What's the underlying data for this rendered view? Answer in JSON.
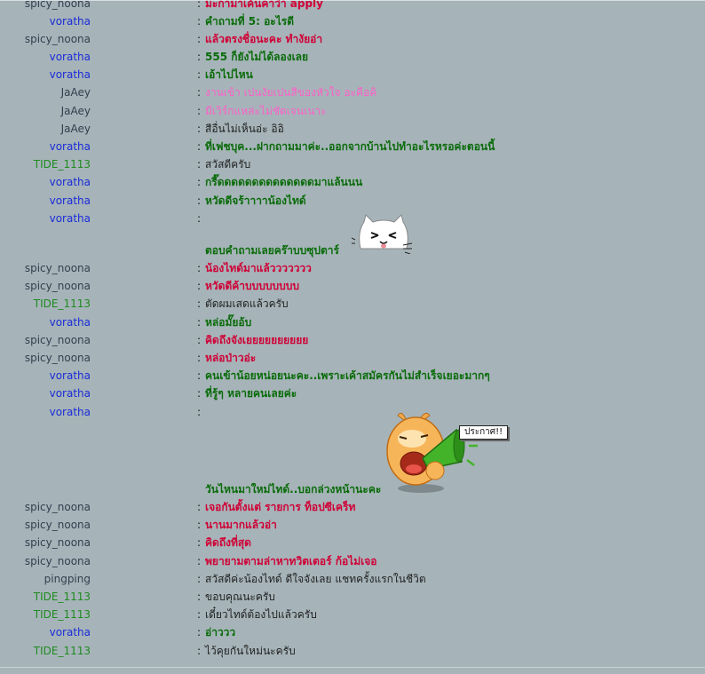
{
  "colors": {
    "background": "#a6b4b9",
    "spicy_noona": "#333e4f",
    "voratha": "#1b2bd8",
    "jaaey": "#333e4f",
    "tide": "#1f8a1f",
    "pingping": "#333e4f",
    "msg_red": "#d00036",
    "msg_green": "#0a6b0a",
    "msg_pink": "#ff5fc8",
    "msg_dark": "#222222"
  },
  "messages": [
    {
      "nick": "spicy_noona",
      "text": "มะกามาเค้นคาว่า apply"
    },
    {
      "nick": "voratha",
      "text": "คำถามที่ 5: อะไรดี"
    },
    {
      "nick": "spicy_noona",
      "text": "แล้วตรงชื่อนะคะ ทำงัยอ่า"
    },
    {
      "nick": "voratha",
      "text": "555 ก็ยังไม่ได้ลองเลย"
    },
    {
      "nick": "voratha",
      "text": "เอ้าไปไหน"
    },
    {
      "nick": "JaAey",
      "text": "งานเข้า เปนงัยเปนสีของหัวใจ อะคือคิ"
    },
    {
      "nick": "JaAey",
      "text": "มีเวิร์กแหล่ะไม่ชัดเจนเนาะ"
    },
    {
      "nick": "JaAey",
      "text": "สีอื่นไม่เห็นอ่ะ อิอิ"
    },
    {
      "nick": "voratha",
      "text": "ที่เฟชบุค...ฝากถามมาค่ะ..ออกจากบ้านไปทำอะไรหรอค่ะตอนนี้"
    },
    {
      "nick": "TIDE_1113",
      "text": "สวัสดีครับ"
    },
    {
      "nick": "voratha",
      "text": "กรี๊ดดดดดดดดดดดดดดมาแล้นนน"
    },
    {
      "nick": "voratha",
      "text": "หวัดดีจร้าาาาน้องไทด์"
    },
    {
      "nick": "voratha",
      "text": ""
    },
    {
      "nick": "spicy_noona",
      "text": "น้องไทด์มาแล้ววววววว"
    },
    {
      "nick": "spicy_noona",
      "text": "หวัดดีค้าบบบบบบบบ"
    },
    {
      "nick": "TIDE_1113",
      "text": "ตัดผมเสดแล้วครับ"
    },
    {
      "nick": "voratha",
      "text": "หล่อมั๊ยอ้บ"
    },
    {
      "nick": "spicy_noona",
      "text": "คิดถึงจังเยยยยยยยยยย"
    },
    {
      "nick": "spicy_noona",
      "text": "หล่อป่าวอ่ะ"
    },
    {
      "nick": "voratha",
      "text": "คนเข้าน้อยหน่อยนะคะ..เพราะเค้าสมัครกันไม่สำเร็จเยอะมากๆ"
    },
    {
      "nick": "voratha",
      "text": "ที่รู้ๆ หลายคนเลยค่ะ"
    },
    {
      "nick": "voratha",
      "text": ""
    },
    {
      "nick": "spicy_noona",
      "text": "เจอกันตั้งแต่ รายการ ท็อปซีเคร็ท"
    },
    {
      "nick": "spicy_noona",
      "text": "นานมากแล้วอ่า"
    },
    {
      "nick": "spicy_noona",
      "text": "คิดถึงที่สุด"
    },
    {
      "nick": "spicy_noona",
      "text": "พยายามตามล่าหาทวิตเตอร์ ก้อไม่เจอ"
    },
    {
      "nick": "pingping",
      "text": "สวัสดีค่ะน้องไทด์ ดีใจจังเลย แชทครั้งแรกในชีวิต"
    },
    {
      "nick": "TIDE_1113",
      "text": "ขอบคุณนะครับ"
    },
    {
      "nick": "TIDE_1113",
      "text": "เดี๋ยวไทด์ต้องไปแล้วครับ"
    },
    {
      "nick": "voratha",
      "text": "อ่าววว"
    },
    {
      "nick": "TIDE_1113",
      "text": "ไว้คุยกันใหม่นะครับ"
    }
  ],
  "followups": [
    {
      "text": "ตอบคำถามเลยคร๊าบบซุปตาร์"
    },
    {
      "text": "วันไหนมาใหม่ไทด์..บอกล่วงหน้านะคะ"
    }
  ],
  "stickers": {
    "cat_icon": "cat-face-icon",
    "megaphone_icon": "megaphone-icon",
    "bubble_label": "ประกาศ!!"
  },
  "colon": ":"
}
